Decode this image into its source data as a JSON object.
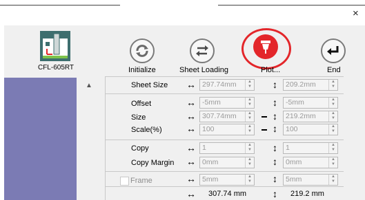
{
  "window": {
    "close_label": "×"
  },
  "machine": {
    "label": "CFL-605RT",
    "icon": "plotter-machine-icon"
  },
  "toolbar": {
    "initialize": "Initialize",
    "sheet_loading": "Sheet Loading",
    "plot": "Plot...",
    "end": "End"
  },
  "form": {
    "sheet_size_label": "Sheet Size",
    "sheet_w": "297.74mm",
    "sheet_h": "209.2mm",
    "offset_label": "Offset",
    "offset_x": "-5mm",
    "offset_y": "-5mm",
    "size_label": "Size",
    "size_w": "307.74mm",
    "size_h": "219.2mm",
    "scale_label": "Scale(%)",
    "scale_x": "100",
    "scale_y": "100",
    "copy_label": "Copy",
    "copy_x": "1",
    "copy_y": "1",
    "copy_margin_label": "Copy Margin",
    "copy_margin_x": "0mm",
    "copy_margin_y": "0mm",
    "frame_label": "Frame",
    "frame_x": "5mm",
    "frame_y": "5mm",
    "total_w": "307.74 mm",
    "total_h": "219.2 mm"
  },
  "colors": {
    "accent_red": "#e3262a",
    "list_bg": "#7b7bb4"
  }
}
